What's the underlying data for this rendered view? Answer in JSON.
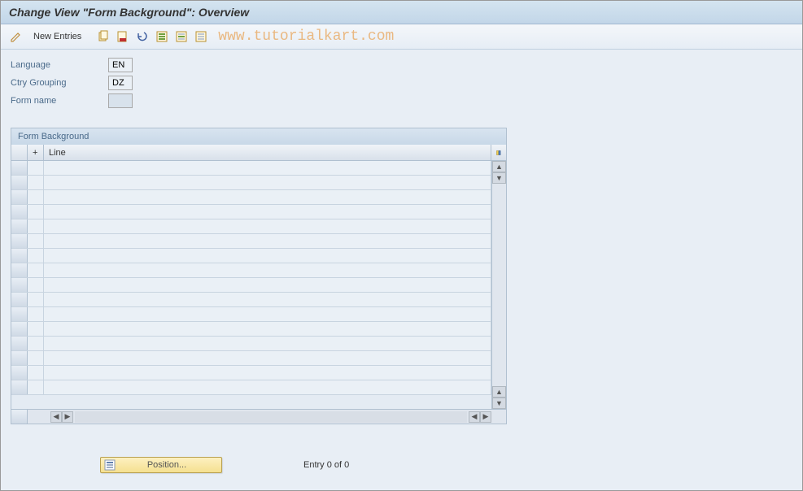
{
  "header": {
    "title": "Change View \"Form Background\": Overview"
  },
  "toolbar": {
    "new_entries_label": "New Entries",
    "watermark": "www.tutorialkart.com"
  },
  "form": {
    "language_label": "Language",
    "language_value": "EN",
    "ctry_grouping_label": "Ctry Grouping",
    "ctry_grouping_value": "DZ",
    "form_name_label": "Form name",
    "form_name_value": ""
  },
  "table": {
    "title": "Form Background",
    "columns": {
      "plus": "+",
      "line": "Line"
    },
    "rows": []
  },
  "footer": {
    "position_label": "Position...",
    "entry_text": "Entry 0 of 0"
  }
}
